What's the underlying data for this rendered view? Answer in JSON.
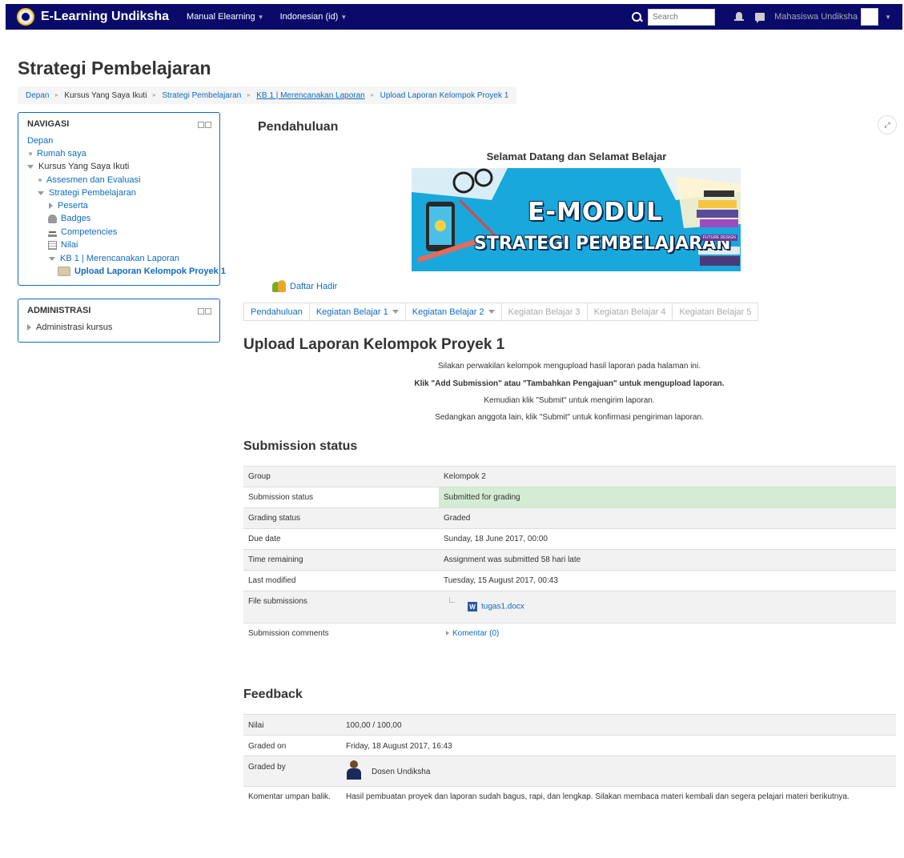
{
  "navbar": {
    "brand": "E-Learning Undiksha",
    "menu_manual": "Manual Elearning",
    "menu_language": "Indonesian (id)",
    "search_placeholder": "Search",
    "username": "Mahasiswa Undiksha",
    "bg_color": "#0a0a6b"
  },
  "page_title": "Strategi Pembelajaran",
  "breadcrumb": [
    "Depan",
    "Kursus Yang Saya Ikuti",
    "Strategi Pembelajaran",
    "KB 1 | Merencanakan Laporan",
    "Upload Laporan Kelompok Proyek 1"
  ],
  "nav_block": {
    "title": "NAVIGASI",
    "items": [
      "Depan",
      "Rumah saya",
      "Kursus Yang Saya Ikuti",
      "Assesmen dan Evaluasi",
      "Strategi Pembelajaran",
      "Peserta",
      "Badges",
      "Competencies",
      "Nilai",
      "KB 1 | Merencanakan Laporan",
      "Upload Laporan Kelompok Proyek 1"
    ]
  },
  "admin_block": {
    "title": "ADMINISTRASI",
    "items": [
      "Administrasi kursus"
    ]
  },
  "section": {
    "title": "Pendahuluan",
    "welcome": "Selamat Datang dan Selamat Belajar",
    "banner_line1": "E-MODUL",
    "banner_line2": "STRATEGI PEMBELAJARAN",
    "banner_tag": "FUTURE DESIGN",
    "attendance": "Daftar Hadir"
  },
  "tabs": [
    "Pendahuluan",
    "Kegiatan Belajar 1",
    "Kegiatan Belajar 2",
    "Kegiatan Belajar 3",
    "Kegiatan Belajar 4",
    "Kegiatan Belajar 5"
  ],
  "activity": {
    "title": "Upload Laporan Kelompok Proyek 1",
    "intro": [
      "Silakan perwakilan kelompok mengupload hasil laporan pada halaman ini.",
      "Klik \"Add Submission\" atau \"Tambahkan Pengajuan\" untuk mengupload laporan.",
      "Kemudian klik \"Submit\" untuk mengirim laporan.",
      "Sedangkan anggota lain, klik \"Submit\" untuk konfirmasi pengiriman laporan."
    ]
  },
  "submission": {
    "heading": "Submission status",
    "rows": [
      {
        "label": "Group",
        "value": "Kelompok 2"
      },
      {
        "label": "Submission status",
        "value": "Submitted for grading"
      },
      {
        "label": "Grading status",
        "value": "Graded"
      },
      {
        "label": "Due date",
        "value": "Sunday, 18 June 2017, 00:00"
      },
      {
        "label": "Time remaining",
        "value": "Assignment was submitted 58 hari late"
      },
      {
        "label": "Last modified",
        "value": "Tuesday, 15 August 2017, 00:43"
      },
      {
        "label": "File submissions",
        "value": "tugas1.docx"
      },
      {
        "label": "Submission comments",
        "value": "Komentar (0)"
      }
    ]
  },
  "feedback": {
    "heading": "Feedback",
    "rows": [
      {
        "label": "Nilai",
        "value": "100,00 / 100,00"
      },
      {
        "label": "Graded on",
        "value": "Friday, 18 August 2017, 16:43"
      },
      {
        "label": "Graded by",
        "value": "Dosen Undiksha"
      },
      {
        "label": "Komentar umpan balik.",
        "value": "Hasil pembuatan proyek dan laporan sudah bagus, rapi, dan lengkap. Silakan membaca materi kembali dan segera pelajari materi berikutnya."
      }
    ]
  }
}
